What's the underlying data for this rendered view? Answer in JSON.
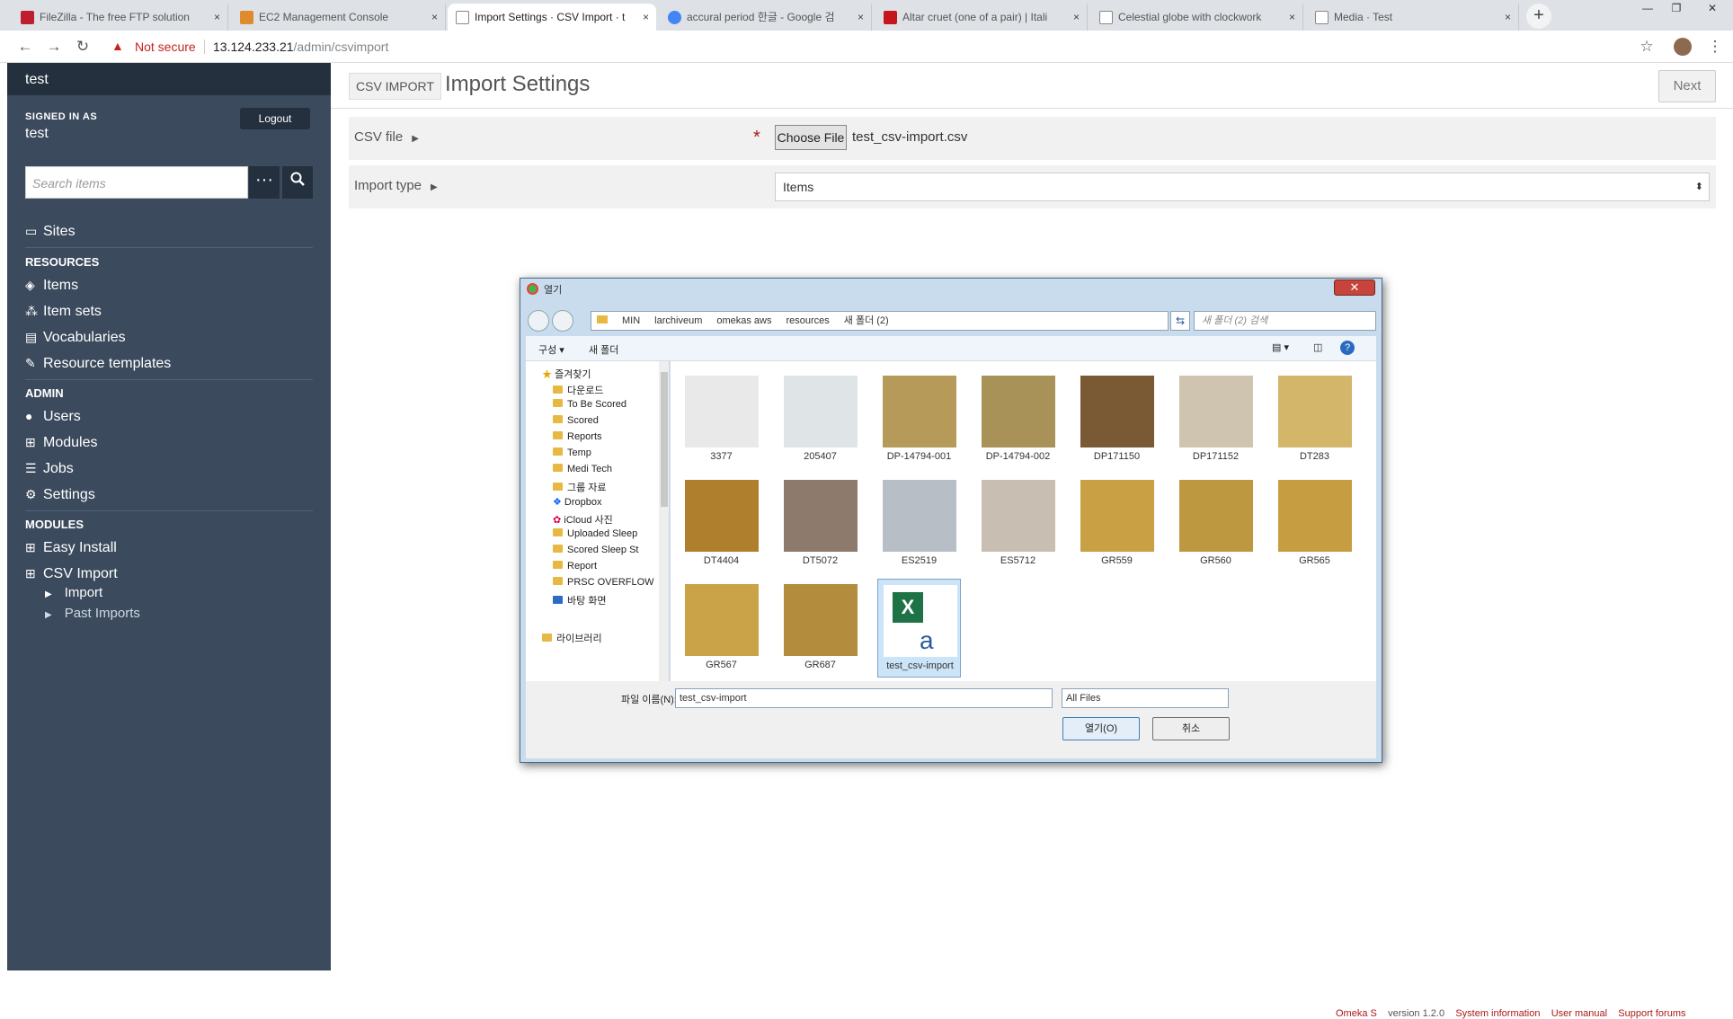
{
  "browser": {
    "tabs": [
      {
        "title": "FileZilla - The free FTP solution",
        "close": "×"
      },
      {
        "title": "EC2 Management Console",
        "close": "×"
      },
      {
        "title": "Import Settings · CSV Import · t",
        "close": "×"
      },
      {
        "title": "accural period 한글 - Google 검",
        "close": "×"
      },
      {
        "title": "Altar cruet (one of a pair) | Itali",
        "close": "×"
      },
      {
        "title": "Celestial globe with clockwork",
        "close": "×"
      },
      {
        "title": "Media · Test",
        "close": "×"
      }
    ],
    "new_tab": "+",
    "security_label": "Not secure",
    "url_host": "13.124.233.21",
    "url_path": "/admin/csvimport",
    "window_controls": [
      "—",
      "❐",
      "✕"
    ]
  },
  "sidebar": {
    "site_title": "test",
    "signed_in_label": "SIGNED IN AS",
    "user": "test",
    "logout": "Logout",
    "search_placeholder": "Search items",
    "sites": "Sites",
    "resources_header": "RESOURCES",
    "resources": [
      "Items",
      "Item sets",
      "Vocabularies",
      "Resource templates"
    ],
    "admin_header": "ADMIN",
    "admin": [
      "Users",
      "Modules",
      "Jobs",
      "Settings"
    ],
    "modules_header": "MODULES",
    "modules": [
      "Easy Install",
      "CSV Import"
    ],
    "csv_sub": [
      "Import",
      "Past Imports"
    ]
  },
  "main": {
    "breadcrumb": "CSV IMPORT",
    "title": "Import Settings",
    "next": "Next",
    "csv_label": "CSV file",
    "choose_file": "Choose File",
    "file_name": "test_csv-import.csv",
    "import_type_label": "Import type",
    "import_type_value": "Items",
    "footer": [
      "Omeka S",
      "version 1.2.0",
      "System information",
      "User manual",
      "Support forums"
    ]
  },
  "dialog": {
    "title": "열기",
    "path": [
      "MIN",
      "larchiveum",
      "omekas aws",
      "resources",
      "새 폴더 (2)"
    ],
    "search_placeholder": "새 폴더 (2) 검색",
    "organize": "구성 ▾",
    "new_folder": "새 폴더",
    "tree": [
      "즐겨찾기",
      "다운로드",
      "To Be Scored",
      "Scored",
      "Reports",
      "Temp",
      "Medi Tech",
      "그룹 자료",
      "Dropbox",
      "iCloud 사진",
      "Uploaded Sleep",
      "Scored Sleep St",
      "Report",
      "PRSC OVERFLOW",
      "바탕 화면",
      "라이브러리"
    ],
    "files": [
      "3377",
      "205407",
      "DP-14794-001",
      "DP-14794-002",
      "DP171150",
      "DP171152",
      "DT283",
      "DT4404",
      "DT5072",
      "ES2519",
      "ES5712",
      "GR559",
      "GR560",
      "GR565",
      "GR567",
      "GR687",
      "test_csv-import"
    ],
    "filename_label": "파일 이름(N):",
    "filename_value": "test_csv-import",
    "filetype": "All Files",
    "open": "열기(O)",
    "cancel": "취소"
  }
}
